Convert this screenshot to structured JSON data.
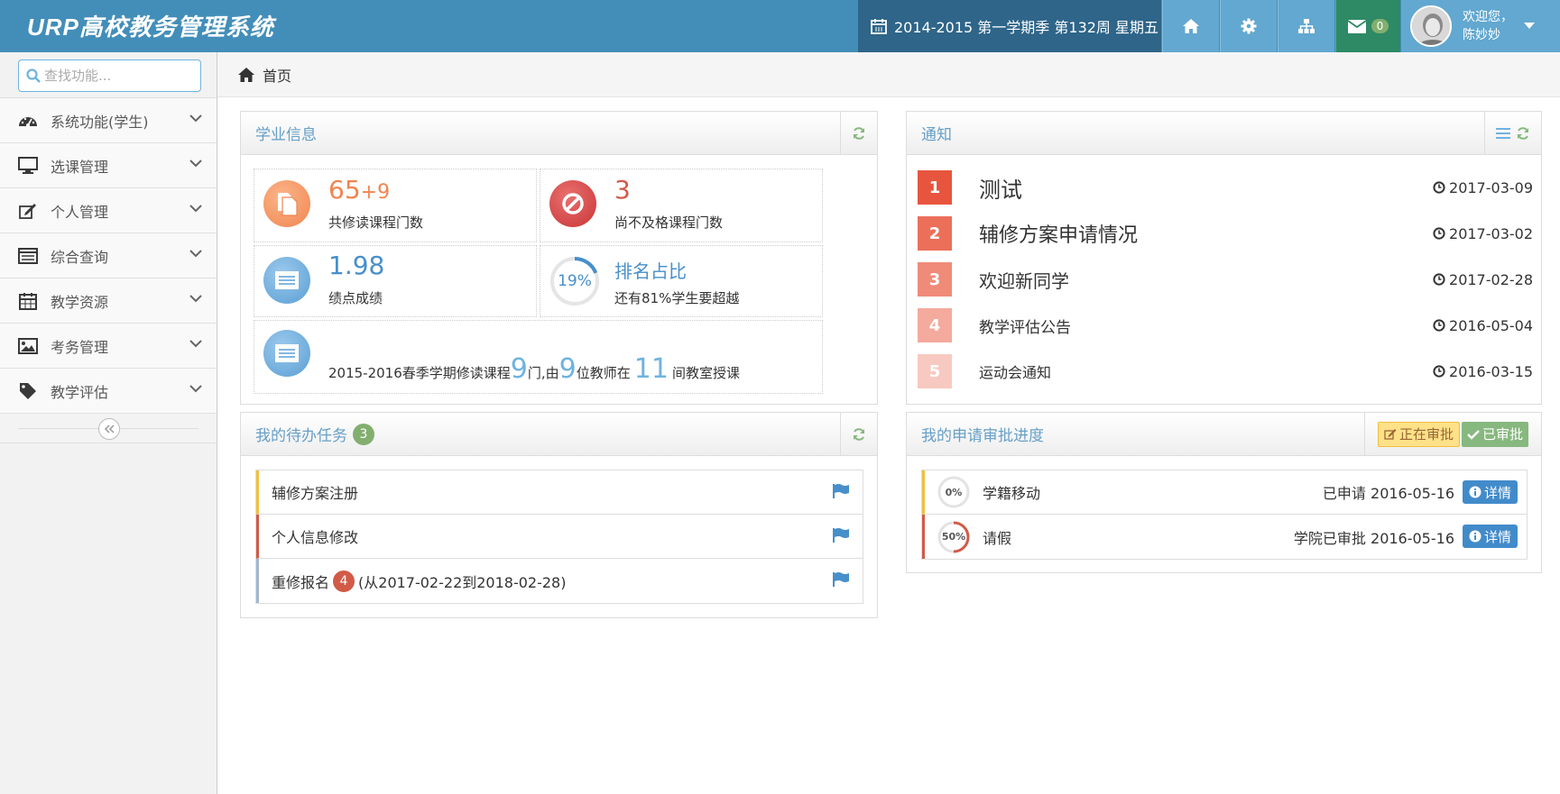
{
  "app": {
    "brand": "URP高校教务管理系统"
  },
  "navbar": {
    "term": "2014-2015 第一学期季 第132周 星期五",
    "mail_count": "0",
    "greeting": "欢迎您，",
    "username": "陈妙妙"
  },
  "sidebar": {
    "search_placeholder": "查找功能...",
    "items": [
      {
        "label": "系统功能(学生)",
        "icon": "dashboard-icon"
      },
      {
        "label": "选课管理",
        "icon": "desktop-icon"
      },
      {
        "label": "个人管理",
        "icon": "edit-icon"
      },
      {
        "label": "综合查询",
        "icon": "list-icon"
      },
      {
        "label": "教学资源",
        "icon": "calendar-icon"
      },
      {
        "label": "考务管理",
        "icon": "picture-icon"
      },
      {
        "label": "教学评估",
        "icon": "tag-icon"
      }
    ]
  },
  "breadcrumb": {
    "home": "首页"
  },
  "academic": {
    "title": "学业信息",
    "courses_main": "65",
    "courses_extra": "+9",
    "courses_label": "共修读课程门数",
    "failed_count": "3",
    "failed_label": "尚不及格课程门数",
    "gpa": "1.98",
    "gpa_label": "绩点成绩",
    "rank_percent": "19%",
    "rank_value": 0.19,
    "rank_title": "排名占比",
    "rank_label": "还有81%学生要超越",
    "semester_prefix": "2015-2016春季学期修读课程",
    "semester_courses": "9",
    "semester_mid1": "门,由",
    "semester_teachers": "9",
    "semester_mid2": "位教师在",
    "semester_rooms": "11",
    "semester_suffix": "间教室授课"
  },
  "notices": {
    "title": "通知",
    "items": [
      {
        "num": "1",
        "title": "测试",
        "date": "2017-03-09",
        "color": "#e8553e"
      },
      {
        "num": "2",
        "title": "辅修方案申请情况",
        "date": "2017-03-02",
        "color": "#ec6f5a"
      },
      {
        "num": "3",
        "title": "欢迎新同学",
        "date": "2017-02-28",
        "color": "#f08b79"
      },
      {
        "num": "4",
        "title": "教学评估公告",
        "date": "2016-05-04",
        "color": "#f4aa9c"
      },
      {
        "num": "5",
        "title": "运动会通知",
        "date": "2016-03-15",
        "color": "#f8c9c0"
      }
    ]
  },
  "tasks": {
    "title": "我的待办任务",
    "count": "3",
    "items": [
      {
        "label": "辅修方案注册",
        "color": "#f0c040"
      },
      {
        "label": "个人信息修改",
        "color": "#d15b47"
      },
      {
        "label": "重修报名",
        "badge": "4",
        "extra": "(从2017-02-22到2018-02-28)",
        "color": "#a0b8d0"
      }
    ]
  },
  "approvals": {
    "title": "我的申请审批进度",
    "tab_pending": "正在审批",
    "tab_done": "已审批",
    "detail_label": "详情",
    "items": [
      {
        "progress_text": "0%",
        "progress": 0,
        "name": "学籍移动",
        "status": "已申请 2016-05-16",
        "color": "#f0c040"
      },
      {
        "progress_text": "50%",
        "progress": 0.5,
        "name": "请假",
        "status": "学院已审批 2016-05-16",
        "color": "#d15b47"
      }
    ]
  }
}
